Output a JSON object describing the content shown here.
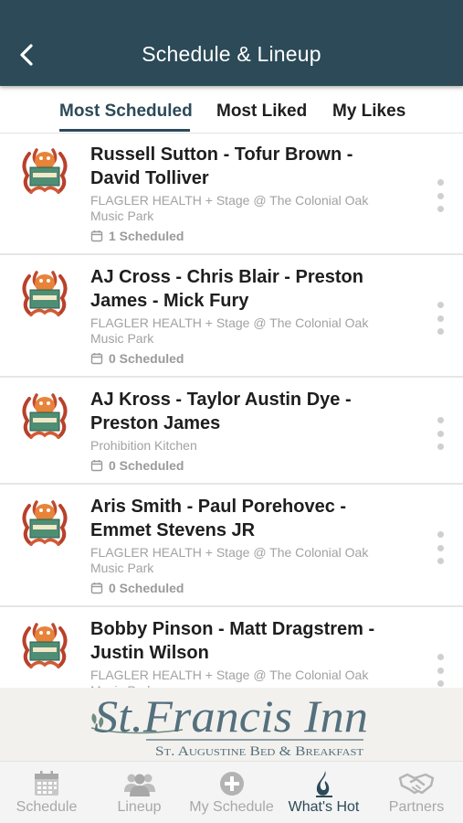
{
  "header": {
    "title": "Schedule & Lineup",
    "back_icon": "chevron-left-icon",
    "background": "#2c4a58"
  },
  "tabs": [
    {
      "label": "Most Scheduled",
      "active": true
    },
    {
      "label": "Most Liked",
      "active": false
    },
    {
      "label": "My Likes",
      "active": false
    }
  ],
  "events": [
    {
      "title": "Russell Sutton - Tofur Brown - David Tolliver",
      "venue": "FLAGLER HEALTH + Stage @ The Colonial Oak Music Park",
      "scheduled": "1 Scheduled"
    },
    {
      "title": "AJ Cross - Chris Blair - Preston James - Mick Fury",
      "venue": "FLAGLER HEALTH + Stage @ The Colonial Oak Music Park",
      "scheduled": "0 Scheduled"
    },
    {
      "title": "AJ Kross - Taylor Austin Dye - Preston James",
      "venue": "Prohibition Kitchen",
      "scheduled": "0 Scheduled"
    },
    {
      "title": "Aris Smith - Paul Porehovec - Emmet Stevens JR",
      "venue": "FLAGLER HEALTH + Stage @ The Colonial Oak Music Park",
      "scheduled": "0 Scheduled"
    },
    {
      "title": "Bobby Pinson - Matt Dragstrem - Justin Wilson",
      "venue": "FLAGLER HEALTH + Stage @ The Colonial Oak Music Park",
      "scheduled": ""
    }
  ],
  "banner": {
    "name": "St.Francis Inn",
    "tagline": "St. Augustine Bed & Breakfast"
  },
  "nav": [
    {
      "label": "Schedule",
      "icon": "calendar-icon",
      "active": false
    },
    {
      "label": "Lineup",
      "icon": "people-icon",
      "active": false
    },
    {
      "label": "My Schedule",
      "icon": "plus-circle-icon",
      "active": false
    },
    {
      "label": "What's Hot",
      "icon": "flame-icon",
      "active": true
    },
    {
      "label": "Partners",
      "icon": "handshake-icon",
      "active": false
    }
  ],
  "colors": {
    "primary": "#2c4a58",
    "muted": "#a8a8a8",
    "divider": "#e6e6e6"
  }
}
